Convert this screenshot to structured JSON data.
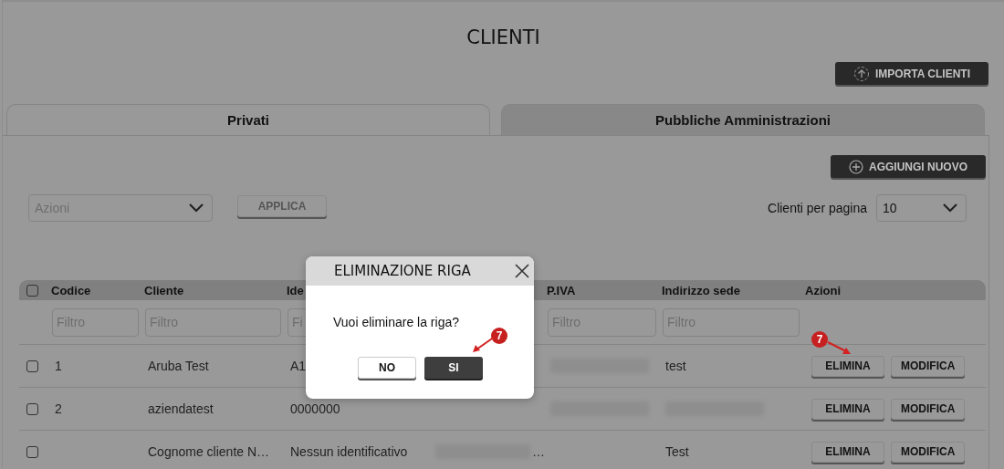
{
  "page": {
    "title": "CLIENTI"
  },
  "import_button": {
    "label": "IMPORTA CLIENTI"
  },
  "tabs": [
    {
      "label": "Privati",
      "selected": true
    },
    {
      "label": "Pubbliche Amministrazioni",
      "selected": false
    }
  ],
  "add_button": {
    "label": "AGGIUNGI NUOVO"
  },
  "bulk_actions": {
    "placeholder": "Azioni",
    "apply": "APPLICA"
  },
  "page_size": {
    "label": "Clienti per pagina",
    "value": "10"
  },
  "table": {
    "select_all": {
      "checked": false
    },
    "columns": [
      {
        "label": "Codice",
        "placeholder": "Filtro"
      },
      {
        "label": "Cliente",
        "placeholder": "Filtro"
      },
      {
        "label": "Ide",
        "placeholder": "Fi"
      },
      {},
      {
        "label": "P.IVA",
        "placeholder": "Filtro"
      },
      {
        "label": "Indirizzo sede",
        "placeholder": "Filtro"
      },
      {
        "label": "Azioni"
      }
    ],
    "rows": [
      {
        "checked": false,
        "cells": [
          {
            "text": "1"
          },
          {
            "text": "Aruba Test"
          },
          {
            "text": "A1"
          },
          {},
          {
            "kind": "blurred"
          },
          {
            "text": "test"
          }
        ],
        "actions": [
          {
            "label": "ELIMINA",
            "callout": "7"
          },
          {
            "label": "MODIFICA"
          }
        ]
      },
      {
        "checked": false,
        "cells": [
          {
            "text": "2"
          },
          {
            "text": "aziendatest"
          },
          {
            "text": "0000000"
          },
          {},
          {
            "kind": "blurred"
          },
          {
            "kind": "blurred"
          }
        ],
        "actions": [
          {
            "label": "ELIMINA"
          },
          {
            "label": "MODIFICA"
          }
        ]
      },
      {
        "checked": false,
        "cells": [
          {},
          {
            "text": "Cognome cliente N…"
          },
          {
            "text": "Nessun identificativo"
          },
          {
            "kind": "blurred",
            "text": "…"
          },
          {},
          {
            "text": "Test"
          }
        ],
        "actions": [
          {
            "label": "ELIMINA"
          },
          {
            "label": "MODIFICA"
          }
        ]
      }
    ]
  },
  "modal": {
    "title": "ELIMINAZIONE RIGA",
    "message": "Vuoi eliminare la riga?",
    "buttons": [
      {
        "label": "NO",
        "kind": "secondary"
      },
      {
        "label": "SI",
        "kind": "primary",
        "callout": "7"
      }
    ]
  }
}
